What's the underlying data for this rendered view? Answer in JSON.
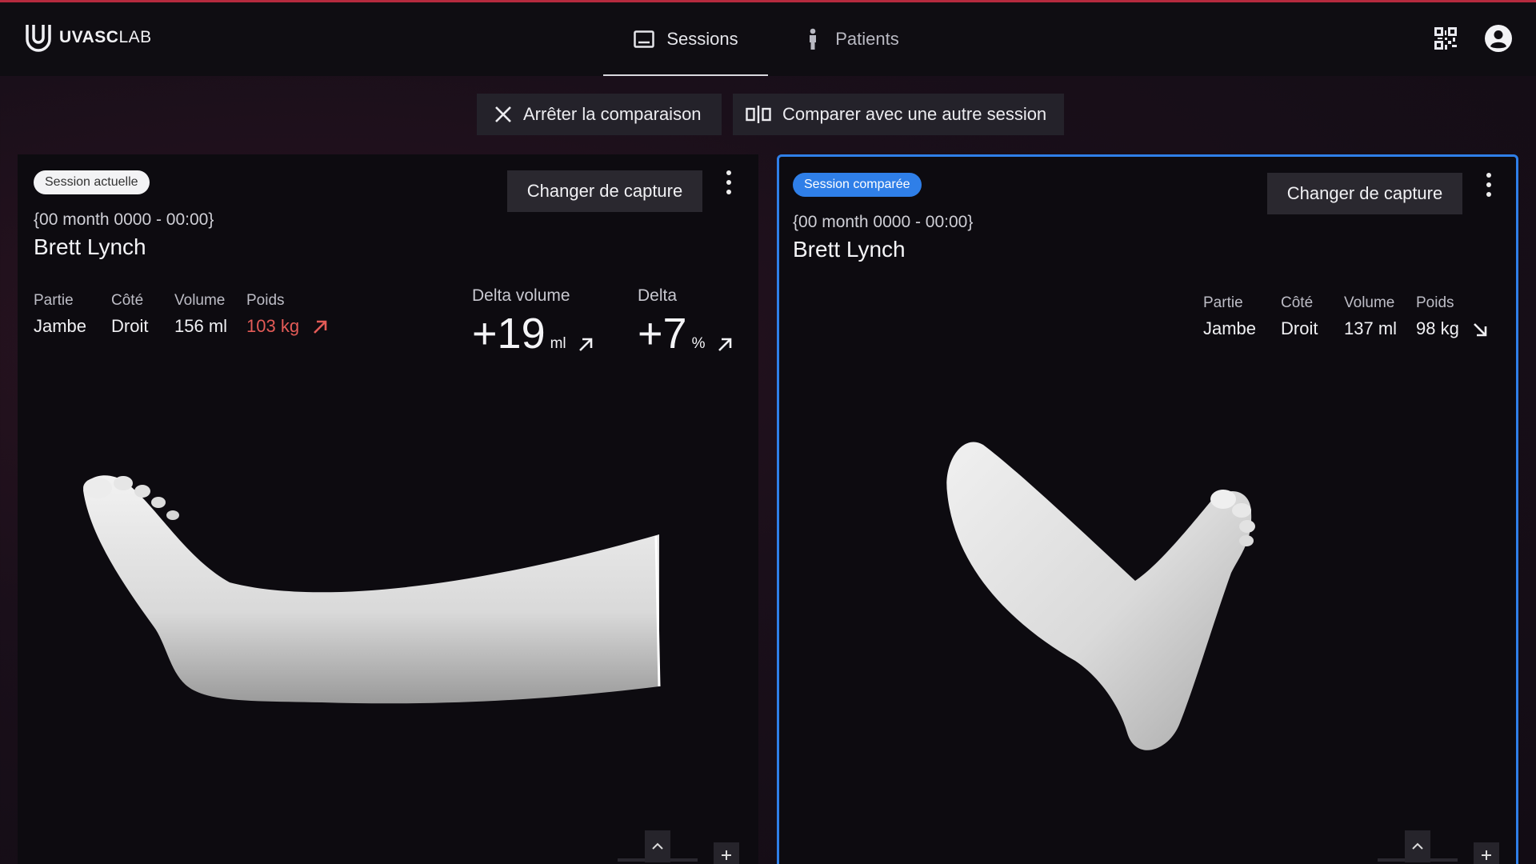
{
  "header": {
    "logo_prefix": "UVASC",
    "logo_suffix": "LAB",
    "tabs": [
      {
        "label": "Sessions",
        "icon": "image-icon",
        "active": true
      },
      {
        "label": "Patients",
        "icon": "person-icon",
        "active": false
      }
    ],
    "right_icons": [
      "qr-code-icon",
      "account-circle-icon"
    ]
  },
  "toolbar": {
    "stop_label": "Arrêter la comparaison",
    "compare_label": "Comparer avec une autre session"
  },
  "left_panel": {
    "badge": "Session actuelle",
    "change_label": "Changer de capture",
    "date": "{00 month 0000 - 00:00}",
    "patient": "Brett Lynch",
    "stats": [
      {
        "label": "Partie",
        "value": "Jambe"
      },
      {
        "label": "Côté",
        "value": "Droit"
      },
      {
        "label": "Volume",
        "value": "156  ml"
      },
      {
        "label": "Poids",
        "value": "103  kg"
      }
    ],
    "delta_volume": {
      "label": "Delta volume",
      "value": "+19",
      "unit": "ml"
    },
    "delta_pct": {
      "label": "Delta",
      "value": "+7",
      "unit": "%"
    }
  },
  "right_panel": {
    "badge": "Session comparée",
    "change_label": "Changer de capture",
    "date": "{00 month 0000 - 00:00}",
    "patient": "Brett Lynch",
    "stats": [
      {
        "label": "Partie",
        "value": "Jambe"
      },
      {
        "label": "Côté",
        "value": "Droit"
      },
      {
        "label": "Volume",
        "value": "137  ml"
      },
      {
        "label": "Poids",
        "value": "98  kg"
      }
    ]
  },
  "colors": {
    "accent_blue": "#2f7fe8",
    "warning_red": "#e35b57",
    "top_line": "#b52a3e"
  }
}
